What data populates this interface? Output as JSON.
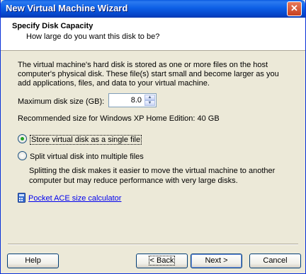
{
  "window": {
    "title": "New Virtual Machine Wizard",
    "close_glyph": "✕"
  },
  "header": {
    "title": "Specify Disk Capacity",
    "subtitle": "How large do you want this disk to be?"
  },
  "body": {
    "description_lines": [
      "The virtual machine's hard disk is stored as one or more files on the host",
      "computer's physical disk. These file(s) start small and become larger as you",
      "add applications, files, and data to your virtual machine."
    ],
    "max_size_label": "Maximum disk size (GB):",
    "max_size_value": "8.0",
    "recommended": "Recommended size for Windows XP Home Edition: 40 GB",
    "radio_single": {
      "label": "Store virtual disk as a single file",
      "selected": true
    },
    "radio_split": {
      "label": "Split virtual disk into multiple files",
      "selected": false
    },
    "split_desc_lines": [
      "Splitting the disk makes it easier to move the virtual machine to another",
      "computer but may reduce performance with very large disks."
    ],
    "calc_link": "Pocket ACE size calculator"
  },
  "buttons": {
    "help": "Help",
    "back": "< Back",
    "next": "Next >",
    "cancel": "Cancel"
  },
  "colors": {
    "titlebar": "#0a5ae0",
    "window_bg": "#ece9d8",
    "link": "#0000ee"
  }
}
